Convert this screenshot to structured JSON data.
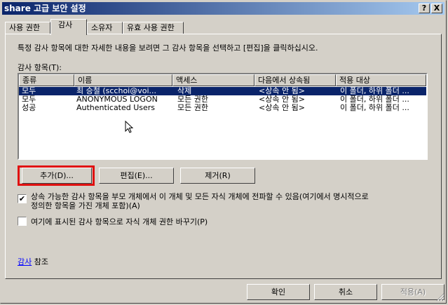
{
  "window": {
    "title": "share 고급 보안 설정",
    "help_btn": "?",
    "close_btn": "X"
  },
  "tabs": [
    {
      "label": "사용 권한"
    },
    {
      "label": "감사"
    },
    {
      "label": "소유자"
    },
    {
      "label": "유효 사용 권한"
    }
  ],
  "description": "특정 감사 항목에 대한 자세한 내용을 보려면 그 감사 항목을 선택하고 [편집]을 클릭하십시오.",
  "audit_list": {
    "label": "감사 항목(T):",
    "columns": [
      "종류",
      "이름",
      "액세스",
      "다음에서 상속됨",
      "적용 대상"
    ],
    "rows": [
      {
        "type": "모두",
        "name": "최 승철 (scchoi@voi...",
        "access": "삭제",
        "inherited": "<상속 안 됨>",
        "apply": "이 폴더, 하위 폴더 ..."
      },
      {
        "type": "모두",
        "name": "ANONYMOUS LOGON",
        "access": "모든 권한",
        "inherited": "<상속 안 됨>",
        "apply": "이 폴더, 하위 폴더 ..."
      },
      {
        "type": "성공",
        "name": "Authenticated Users",
        "access": "모든 권한",
        "inherited": "<상속 안 됨>",
        "apply": "이 폴더, 하위 폴더 ..."
      }
    ]
  },
  "buttons": {
    "add": "추가(D)...",
    "edit": "편집(E)...",
    "remove": "제거(R)"
  },
  "checkboxes": {
    "inherit_line1": "상속 가능한 감사 항목을 부모 개체에서 이 개체 및 모든 자식 개체에 전파할 수 있음(여기에서 명시적으로",
    "inherit_line2": "정의한 항목을 가진 개체 포함)(A)",
    "inherit_checked": "✔",
    "replace": "여기에 표시된 감사 항목으로 자식 개체 권한 바꾸기(P)"
  },
  "see_also": {
    "link": "감사",
    "suffix": " 참조"
  },
  "footer": {
    "ok": "확인",
    "cancel": "취소",
    "apply": "적용(A)"
  }
}
